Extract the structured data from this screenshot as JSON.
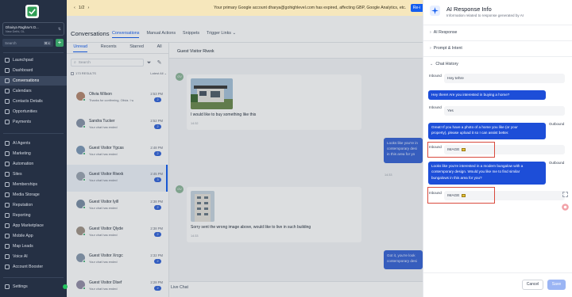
{
  "sidebar": {
    "account_name": "Dhairya Raghav's D...",
    "account_location": "New Delhi, DL",
    "search_placeholder": "Search",
    "search_shortcut": "⌘ K",
    "add_label": "+",
    "items": [
      {
        "label": "Launchpad",
        "icon": "rocket-icon"
      },
      {
        "label": "Dashboard",
        "icon": "dashboard-icon"
      },
      {
        "label": "Conversations",
        "icon": "chat-icon",
        "active": true
      },
      {
        "label": "Calendars",
        "icon": "calendar-icon"
      },
      {
        "label": "Contacts Details",
        "icon": "contacts-icon"
      },
      {
        "label": "Opportunities",
        "icon": "opportunities-icon"
      },
      {
        "label": "Payments",
        "icon": "payments-icon"
      },
      {
        "label": "AI Agents",
        "icon": "ai-agents-icon"
      },
      {
        "label": "Marketing",
        "icon": "marketing-icon"
      },
      {
        "label": "Automation",
        "icon": "automation-icon"
      },
      {
        "label": "Sites",
        "icon": "sites-icon"
      },
      {
        "label": "Memberships",
        "icon": "memberships-icon"
      },
      {
        "label": "Media Storage",
        "icon": "media-icon"
      },
      {
        "label": "Reputation",
        "icon": "reputation-icon"
      },
      {
        "label": "Reporting",
        "icon": "reporting-icon"
      },
      {
        "label": "App Marketplace",
        "icon": "marketplace-icon"
      },
      {
        "label": "Mobile App",
        "icon": "mobile-icon"
      },
      {
        "label": "Map Leads",
        "icon": "map-icon"
      },
      {
        "label": "Voice AI",
        "icon": "voice-icon"
      },
      {
        "label": "Account Booster",
        "icon": "booster-icon"
      },
      {
        "label": "Settings",
        "icon": "gear-icon"
      }
    ]
  },
  "banner": {
    "pager": "1/2",
    "message": "Your primary Google account dharya@gohighlevel.com has expired, affecting GBP, Google Analytics, etc.",
    "button": "Re-i"
  },
  "conversations": {
    "title": "Conversations",
    "top_tabs": [
      "Conversations",
      "Manual Actions",
      "Snippets",
      "Trigger Links ⌄"
    ],
    "sub_tabs": [
      "Unread",
      "Recents",
      "Starred",
      "All"
    ],
    "search_placeholder": "Search",
    "results_label": "173 RESULTS",
    "sort_label": "Latest All ⌄",
    "items": [
      {
        "name": "Olivia Wilson",
        "preview": "Thanks for confirming, Olivia. I woul...",
        "time": "2:53 PM",
        "badge": "2",
        "avatar": "#b78a72"
      },
      {
        "name": "Sandra Tucker",
        "preview": "Your chat has ended",
        "time": "2:52 PM",
        "badge": "2",
        "avatar": "#8a96aa"
      },
      {
        "name": "Guest Visitor Ygcas",
        "preview": "Your chat has ended",
        "time": "2:48 PM",
        "badge": "2",
        "avatar": "#7f9ab8"
      },
      {
        "name": "Guest Visitor Riwxk",
        "preview": "Your chat has ended",
        "time": "2:45 PM",
        "badge": "3",
        "avatar": "#9da6b3",
        "selected": true
      },
      {
        "name": "Guest Visitor Iyill",
        "preview": "Your chat has ended",
        "time": "2:38 PM",
        "badge": "2",
        "avatar": "#7c8fa6"
      },
      {
        "name": "Guest Visitor Qlyde",
        "preview": "Your chat has ended",
        "time": "2:38 PM",
        "badge": "2",
        "avatar": "#a3968a"
      },
      {
        "name": "Guest Visitor Xrcgc",
        "preview": "Your chat has ended",
        "time": "2:32 PM",
        "badge": "2",
        "avatar": "#8b9bb0"
      },
      {
        "name": "Guest Visitor Dlsef",
        "preview": "Your chat has ended",
        "time": "2:28 PM",
        "badge": "2",
        "avatar": "#968fa8"
      }
    ]
  },
  "chat": {
    "title": "Guest Visitor Riwxk",
    "avatar_initials": "GV",
    "messages": [
      {
        "caption": "I would like to buy something like this",
        "time": "14:32"
      },
      {
        "text": "Looks like you're in\ncontemporary desi\nin this area for yo",
        "time": "14:33"
      },
      {
        "caption": "Sorry sent the wrong image above, would like to live in such building",
        "time": "14:33"
      },
      {
        "text": "Got it, you're look\ncontemporary desi",
        "time": ""
      }
    ],
    "footer_label": "Live Chat"
  },
  "drawer": {
    "title": "AI Response Info",
    "subtitle": "Information related to response generated by AI",
    "sections": [
      "AI Response",
      "Prompt & Intent",
      "Chat History"
    ],
    "chat_history": {
      "inbound_label": "Inbound",
      "outbound_label": "Outbound",
      "entries": [
        {
          "dir": "in",
          "text": "Hey tehre"
        },
        {
          "dir": "out",
          "text": "Hey there! Are you interested in buying a home?"
        },
        {
          "dir": "in",
          "text": "Yes"
        },
        {
          "dir": "out",
          "text": "Great! If you have a photo of a home you like (or your\nproperty), please upload it so I can assist better."
        },
        {
          "dir": "in",
          "text": "IMAGE"
        },
        {
          "dir": "out",
          "text": "Looks like you're interested in a modern bungalow with a\ncontemporary design. Would you like me to find similar\nbungalows in this area for you?"
        },
        {
          "dir": "in",
          "text": "IMAGE"
        }
      ]
    },
    "cancel_label": "Cancel",
    "save_label": "Save",
    "colors": {
      "accent": "#155eef",
      "outbound_bubble": "#1d4ed8",
      "highlight_box": "#d94a3d"
    }
  }
}
